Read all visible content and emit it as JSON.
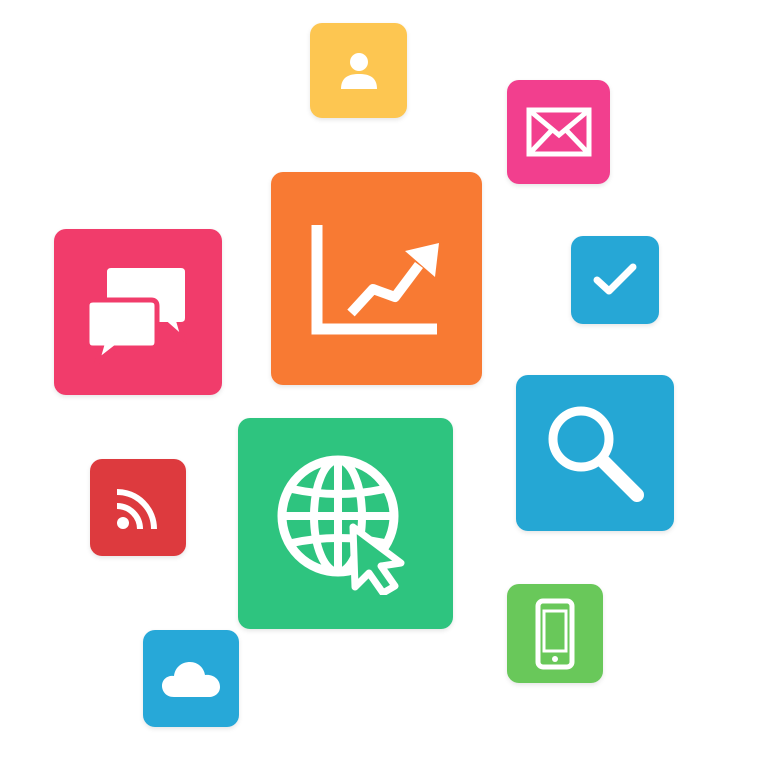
{
  "tiles": {
    "user": {
      "icon": "user-icon",
      "color": "#FDC651"
    },
    "mail": {
      "icon": "envelope-icon",
      "color": "#F23F8E"
    },
    "chat": {
      "icon": "chat-bubbles-icon",
      "color": "#F13C6B"
    },
    "growth": {
      "icon": "growth-chart-icon",
      "color": "#F87A33"
    },
    "check": {
      "icon": "checkmark-icon",
      "color": "#26A7D6"
    },
    "search": {
      "icon": "search-icon",
      "color": "#25A7D4"
    },
    "rss": {
      "icon": "rss-icon",
      "color": "#DD3A3E"
    },
    "web": {
      "icon": "globe-cursor-icon",
      "color": "#2EC47F"
    },
    "mobile": {
      "icon": "smartphone-icon",
      "color": "#69C85A"
    },
    "cloud": {
      "icon": "cloud-icon",
      "color": "#27A8D8"
    }
  }
}
